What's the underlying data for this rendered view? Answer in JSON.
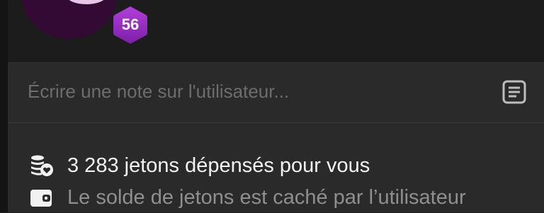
{
  "profile": {
    "level": "56",
    "colors": {
      "badge": "#9b2bc4",
      "avatar": "#320a34"
    }
  },
  "note": {
    "placeholder": "Écrire une note sur l'utilisateur...",
    "icon": "notepad-icon"
  },
  "stats": {
    "tokens_spent": {
      "icon": "coins-heart-icon",
      "text": "3 283 jetons dépensés pour vous"
    },
    "balance": {
      "icon": "wallet-icon",
      "text": "Le solde de jetons est caché par l’utilisateur"
    }
  }
}
